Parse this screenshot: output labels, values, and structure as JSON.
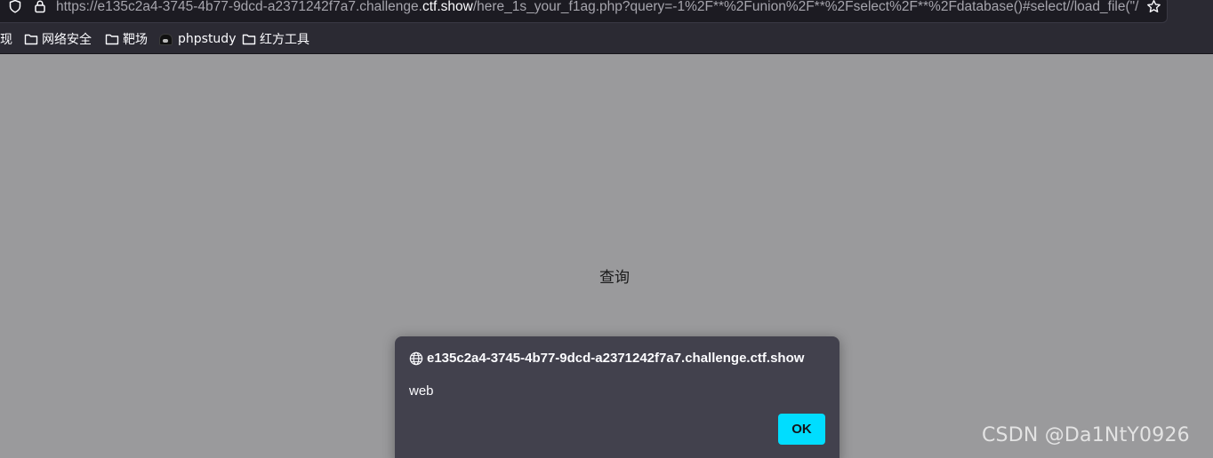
{
  "urlbar": {
    "url_prefix": "https://e135c2a4-3745-4b77-9dcd-a2371242f7a7.challenge.",
    "url_domain": "ctf.show",
    "url_path": "/here_1s_your_f1ag.php?query=-1%2F**%2Funion%2F**%2Fselect%2F**%2Fdatabase()#select//load_file(\"/"
  },
  "bookmarks": {
    "items": [
      {
        "label": "现"
      },
      {
        "label": "网络安全"
      },
      {
        "label": "靶场"
      },
      {
        "label": "phpstudy"
      },
      {
        "label": "红方工具"
      }
    ]
  },
  "page": {
    "query_label": "查询"
  },
  "dialog": {
    "origin": "e135c2a4-3745-4b77-9dcd-a2371242f7a7.challenge.ctf.show",
    "message": "web",
    "ok_label": "OK"
  },
  "watermark": {
    "text": "CSDN @Da1NtY0926"
  },
  "colors": {
    "chrome_bg": "#2b2a33",
    "page_bg": "#9a9a9c",
    "dialog_bg": "#42414d",
    "accent": "#00ddff"
  }
}
